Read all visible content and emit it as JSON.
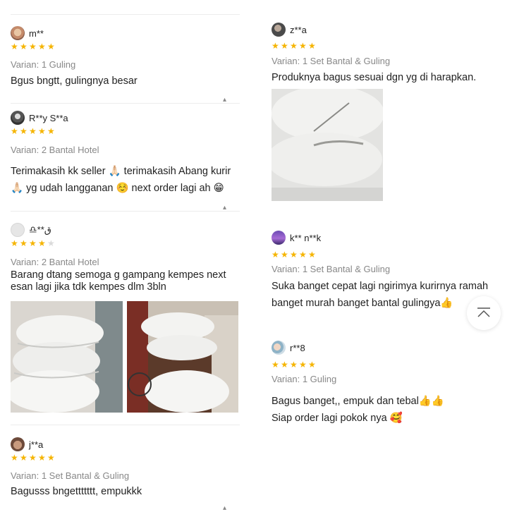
{
  "left_column": {
    "reviews": [
      {
        "username": "m**",
        "rating": 5,
        "variant": "Varian: 1 Guling",
        "comment": "Bgus bngtt, gulingnya besar"
      },
      {
        "username": "R**y S**a",
        "rating": 5,
        "variant": "Varian: 2 Bantal Hotel",
        "comment_line1": "Terimakasih kk seller 🙏🏻 terimakasih Abang kurir",
        "comment_line2": "🙏🏻 yg udah langganan ☺️ next order lagi ah 😁"
      },
      {
        "username": "♎**ق",
        "rating": 4,
        "variant": "Varian: 2 Bantal Hotel",
        "comment_line1": "Barang dtang semoga g gampang kempes next",
        "comment_line2": "esan lagi jika tdk kempes dlm 3bln"
      },
      {
        "username": "j**a",
        "rating": 5,
        "variant": "Varian: 1 Set Bantal & Guling",
        "comment": "Bagusss bngettttttt, empukkk"
      }
    ]
  },
  "right_column": {
    "reviews": [
      {
        "username": "z**a",
        "rating": 5,
        "variant": "Varian: 1 Set Bantal & Guling",
        "comment": "Produknya bagus sesuai dgn yg di harapkan."
      },
      {
        "username": "k** n**k",
        "rating": 5,
        "variant": "Varian: 1 Set Bantal & Guling",
        "comment_line1": "Suka banget cepat lagi ngirimya kurirnya ramah",
        "comment_line2": "banget murah banget bantal gulingya👍"
      },
      {
        "username": "r**8",
        "rating": 5,
        "variant": "Varian: 1 Guling",
        "comment_line1": "Bagus banget,, empuk dan tebal👍👍",
        "comment_line2": "Siap order lagi pokok nya 🥰"
      }
    ]
  },
  "icons": {
    "star": "star-icon",
    "collapse": "caret-up-icon",
    "back_to_top": "back-to-top-icon"
  },
  "colors": {
    "star": "#f5b400",
    "star_empty": "#dadada",
    "variant_text": "#888888",
    "divider": "#ececec"
  }
}
